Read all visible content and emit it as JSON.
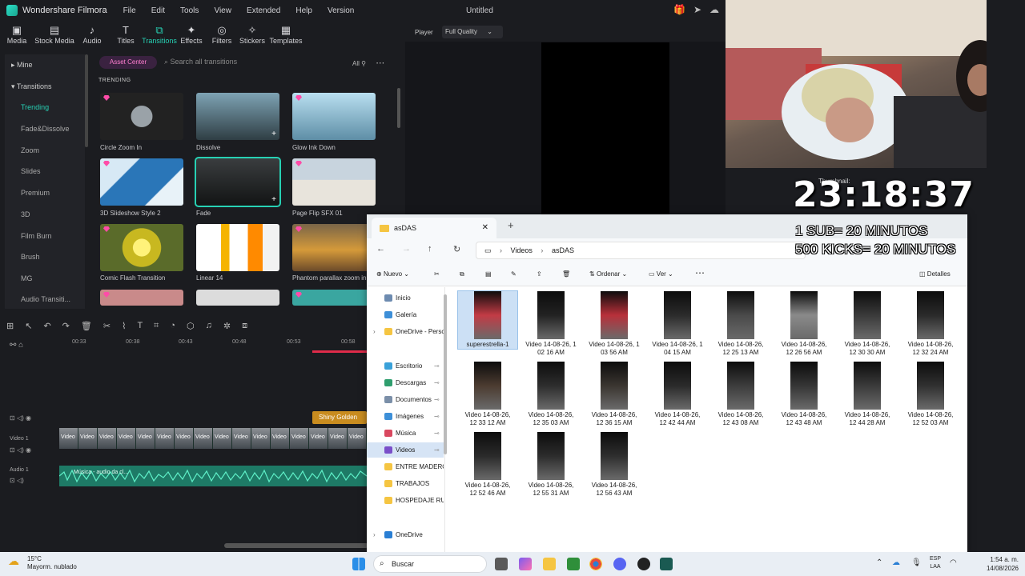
{
  "filmora": {
    "app_title": "Wondershare Filmora",
    "menu": [
      "File",
      "Edit",
      "Tools",
      "View",
      "Extended",
      "Help",
      "Version"
    ],
    "project_name": "Untitled",
    "toolbar": [
      "Media",
      "Stock Media",
      "Audio",
      "Titles",
      "Transitions",
      "Effects",
      "Filters",
      "Stickers",
      "Templates"
    ],
    "active_tool": "Transitions",
    "nav": {
      "mine": "Mine",
      "transitions": "Transitions",
      "items": [
        "Trending",
        "Fade&Dissolve",
        "Zoom",
        "Slides",
        "Premium",
        "3D",
        "Film Burn",
        "Brush",
        "MG",
        "Audio Transiti..."
      ]
    },
    "asset_center": "Asset Center",
    "search_placeholder": "Search all transitions",
    "filter_label": "All",
    "section_title": "TRENDING",
    "transitions": [
      "Circle Zoom In",
      "Dissolve",
      "Glow Ink Down",
      "3D Slideshow Style 2",
      "Fade",
      "Page Flip SFX 01",
      "Comic Flash Transition",
      "Linear 14",
      "Phantom parallax zoom in"
    ],
    "player_label": "Player",
    "quality": "Full Quality",
    "ruler": [
      "00:33",
      "00:38",
      "00:43",
      "00:48",
      "00:53",
      "00:58"
    ],
    "track_video": "Video 1",
    "track_audio": "Audio 1",
    "clip_label": "Video",
    "audio_clip_label": "Música - audio da cl...",
    "badge": "Shiny Golden"
  },
  "stream": {
    "thumbnail_label": "Thumbnail:",
    "timer": "23:18:37",
    "line1": "1 SUB= 20 MINUTOS",
    "line2": "500 KICKS= 20 MINUTOS"
  },
  "explorer": {
    "tab_title": "asDAS",
    "breadcrumb": [
      "Videos",
      "asDAS"
    ],
    "commands": {
      "new": "Nuevo",
      "sort": "Ordenar",
      "view": "Ver",
      "details": "Detalles"
    },
    "sidebar": [
      "Inicio",
      "Galería",
      "OneDrive - Perso",
      "Escritorio",
      "Descargas",
      "Documentos",
      "Imágenes",
      "Música",
      "Videos",
      "ENTRE MADERO",
      "TRABAJOS",
      "HOSPEDAJE RUI",
      "OneDrive"
    ],
    "files": [
      [
        "superestrella-1"
      ],
      [
        "Video 14-08-26, 1",
        "02 16 AM"
      ],
      [
        "Video 14-08-26, 1",
        "03 56 AM"
      ],
      [
        "Video 14-08-26, 1",
        "04 15 AM"
      ],
      [
        "Video 14-08-26,",
        "12 25 13 AM"
      ],
      [
        "Video 14-08-26,",
        "12 26 56 AM"
      ],
      [
        "Video 14-08-26,",
        "12 30 30 AM"
      ],
      [
        "Video 14-08-26,",
        "12 32 24 AM"
      ],
      [
        "Video 14-08-26,",
        "12 33 12 AM"
      ],
      [
        "Video 14-08-26,",
        "12 35 03 AM"
      ],
      [
        "Video 14-08-26,",
        "12 36 15 AM"
      ],
      [
        "Video 14-08-26,",
        "12 42 44 AM"
      ],
      [
        "Video 14-08-26,",
        "12 43 08 AM"
      ],
      [
        "Video 14-08-26,",
        "12 43 48 AM"
      ],
      [
        "Video 14-08-26,",
        "12 44 28 AM"
      ],
      [
        "Video 14-08-26,",
        "12 52 03 AM"
      ],
      [
        "Video 14-08-26,",
        "12 52 46 AM"
      ],
      [
        "Video 14-08-26,",
        "12 55 31 AM"
      ],
      [
        "Video 14-08-26,",
        "12 56 43 AM"
      ]
    ]
  },
  "taskbar": {
    "temp": "15°C",
    "weather": "Mayorm. nublado",
    "search": "Buscar",
    "lang1": "ESP",
    "lang2": "LAA",
    "time": "1:54 a. m.",
    "date": "14/08/2026"
  }
}
